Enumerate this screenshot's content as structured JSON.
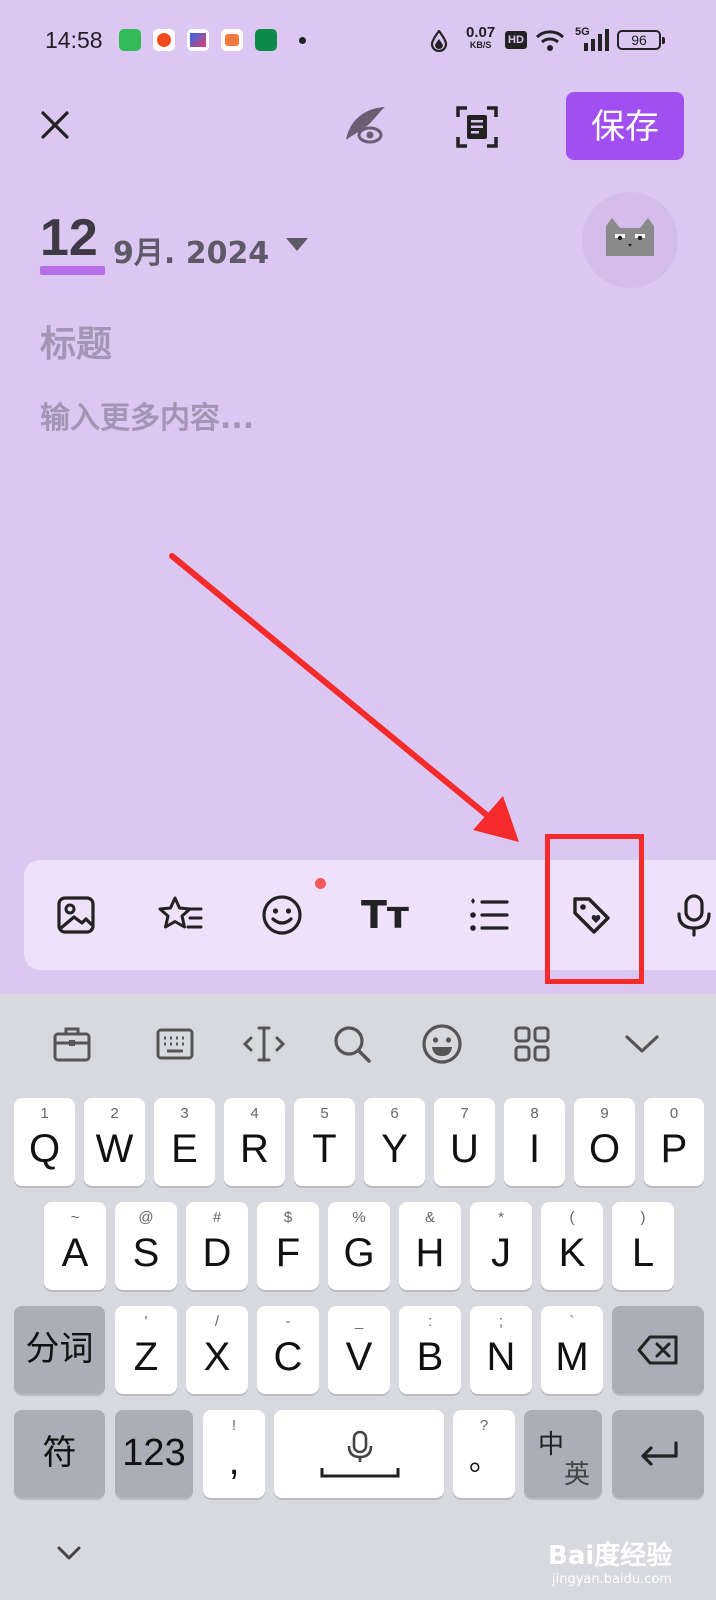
{
  "status_bar": {
    "time": "14:58",
    "net_speed": "0.07",
    "net_unit": "KB/S",
    "hd": "HD",
    "network": "5G",
    "battery": "96"
  },
  "header": {
    "save_label": "保存"
  },
  "date": {
    "day": "12",
    "month_year": "9月. 2024"
  },
  "editor": {
    "title_placeholder": "标题",
    "body_placeholder": "输入更多内容..."
  },
  "toolbar": {
    "items": [
      "image-icon",
      "star-list-icon",
      "emoji-icon",
      "text-size-icon",
      "list-icon",
      "tag-icon",
      "microphone-icon"
    ],
    "text_size_label": "Tт"
  },
  "keyboard": {
    "row1": [
      {
        "key": "Q",
        "sub": "1"
      },
      {
        "key": "W",
        "sub": "2"
      },
      {
        "key": "E",
        "sub": "3"
      },
      {
        "key": "R",
        "sub": "4"
      },
      {
        "key": "T",
        "sub": "5"
      },
      {
        "key": "Y",
        "sub": "6"
      },
      {
        "key": "U",
        "sub": "7"
      },
      {
        "key": "I",
        "sub": "8"
      },
      {
        "key": "O",
        "sub": "9"
      },
      {
        "key": "P",
        "sub": "0"
      }
    ],
    "row2": [
      {
        "key": "A",
        "sub": "~"
      },
      {
        "key": "S",
        "sub": "@"
      },
      {
        "key": "D",
        "sub": "#"
      },
      {
        "key": "F",
        "sub": "$"
      },
      {
        "key": "G",
        "sub": "%"
      },
      {
        "key": "H",
        "sub": "&"
      },
      {
        "key": "J",
        "sub": "*"
      },
      {
        "key": "K",
        "sub": "("
      },
      {
        "key": "L",
        "sub": ")"
      }
    ],
    "row3": [
      {
        "key": "Z",
        "sub": "'"
      },
      {
        "key": "X",
        "sub": "/"
      },
      {
        "key": "C",
        "sub": "-"
      },
      {
        "key": "V",
        "sub": "_"
      },
      {
        "key": "B",
        "sub": ":"
      },
      {
        "key": "N",
        "sub": ";"
      },
      {
        "key": "M",
        "sub": "`"
      }
    ],
    "segment_label": "分词",
    "symbol_label": "符",
    "numbers_label": "123",
    "comma": {
      "key": ",",
      "sub": "!"
    },
    "period": {
      "key": "。",
      "sub": "?"
    },
    "lang_top": "中",
    "lang_bottom": "英"
  },
  "watermark": {
    "text": "Bai度经验",
    "url": "jingyan.baidu.com"
  },
  "colors": {
    "background": "#dcc7f2",
    "accent": "#a14ff0",
    "highlight": "#f52b2b"
  }
}
